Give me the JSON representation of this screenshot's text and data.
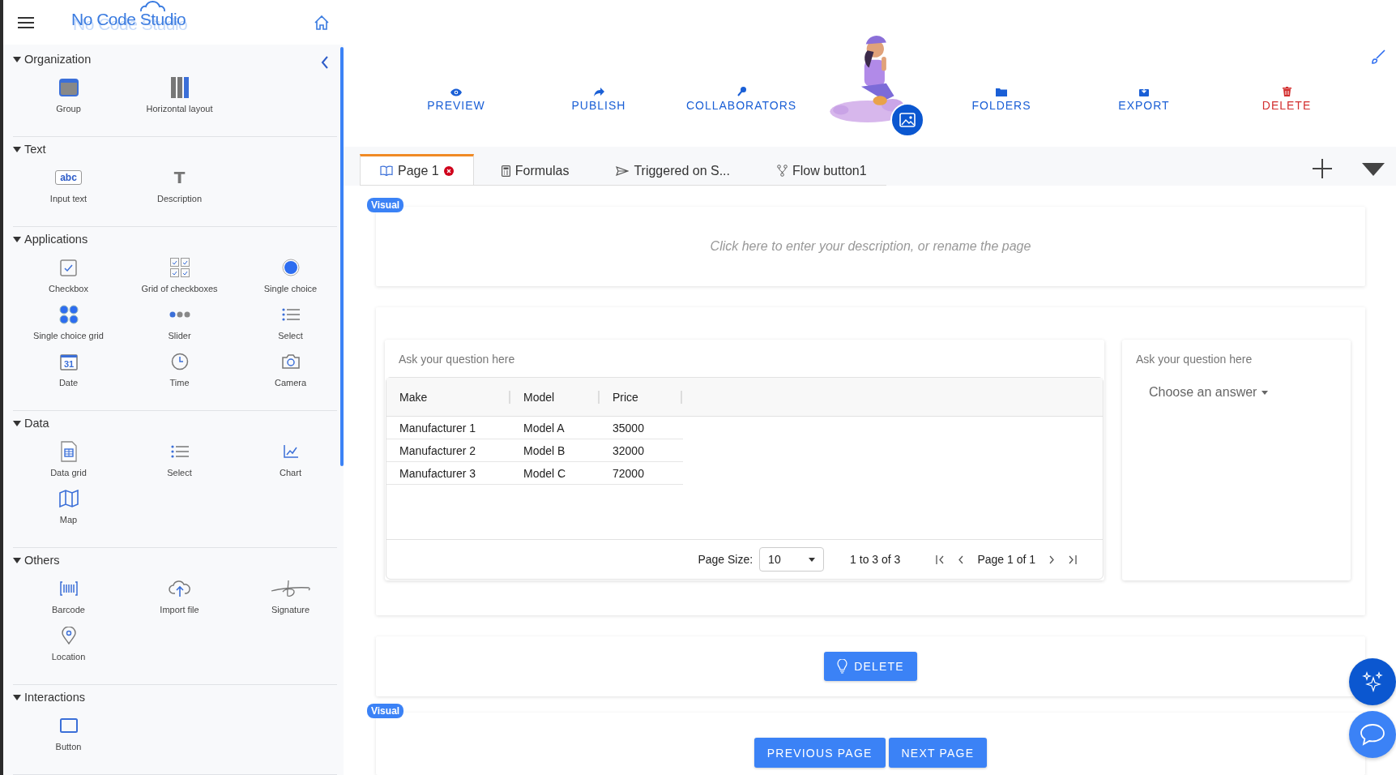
{
  "app": {
    "title": "No Code Studio"
  },
  "sidebar": {
    "sections": [
      {
        "title": "Organization",
        "expanded": true,
        "items": [
          {
            "label": "Group",
            "kind": "group"
          },
          {
            "label": "Horizontal layout",
            "kind": "columns"
          }
        ]
      },
      {
        "title": "Text",
        "expanded": true,
        "items": [
          {
            "label": "Input text",
            "kind": "text-input",
            "glyph": "abc"
          },
          {
            "label": "Description",
            "kind": "text",
            "glyph": "T"
          }
        ]
      },
      {
        "title": "Applications",
        "expanded": true,
        "items": [
          {
            "label": "Checkbox",
            "kind": "checkbox"
          },
          {
            "label": "Grid of checkboxes",
            "kind": "checkbox-grid"
          },
          {
            "label": "Single choice",
            "kind": "radio"
          },
          {
            "label": "Single choice grid",
            "kind": "radio-grid"
          },
          {
            "label": "Slider",
            "kind": "dots"
          },
          {
            "label": "Select",
            "kind": "list"
          },
          {
            "label": "Date",
            "kind": "calendar",
            "glyph": "31"
          },
          {
            "label": "Time",
            "kind": "clock"
          },
          {
            "label": "Camera",
            "kind": "camera"
          }
        ]
      },
      {
        "title": "Data",
        "expanded": true,
        "items": [
          {
            "label": "Data grid",
            "kind": "sheet"
          },
          {
            "label": "Select",
            "kind": "list"
          },
          {
            "label": "Chart",
            "kind": "chart"
          },
          {
            "label": "Map",
            "kind": "map"
          }
        ]
      },
      {
        "title": "Others",
        "expanded": true,
        "items": [
          {
            "label": "Barcode",
            "kind": "barcode"
          },
          {
            "label": "Import file",
            "kind": "upload"
          },
          {
            "label": "Signature",
            "kind": "signature"
          },
          {
            "label": "Location",
            "kind": "pin"
          }
        ]
      },
      {
        "title": "Interactions",
        "expanded": true,
        "items": [
          {
            "label": "Button",
            "kind": "button"
          }
        ]
      }
    ]
  },
  "toolbar": {
    "actions": [
      {
        "label": "PREVIEW",
        "kind": "eye",
        "danger": false
      },
      {
        "label": "PUBLISH",
        "kind": "share",
        "danger": false
      },
      {
        "label": "COLLABORATORS",
        "kind": "key",
        "danger": false
      },
      {
        "label": "FOLDERS",
        "kind": "folder",
        "danger": false
      },
      {
        "label": "EXPORT",
        "kind": "download",
        "danger": false
      },
      {
        "label": "DELETE",
        "kind": "trash",
        "danger": true
      }
    ]
  },
  "tabs": [
    {
      "label": "Page 1",
      "kind": "page",
      "selected": true,
      "error": true
    },
    {
      "label": "Formulas",
      "kind": "calculator",
      "selected": false,
      "error": false
    },
    {
      "label": "Triggered on S...",
      "kind": "send",
      "selected": false,
      "error": false
    },
    {
      "label": "Flow button1",
      "kind": "fork",
      "selected": false,
      "error": false
    }
  ],
  "description_block": {
    "badge": "Visual",
    "hint": "Click here to enter your description, or rename the page"
  },
  "grid_question": {
    "question_hint": "Ask your question here",
    "columns": [
      "Make",
      "Model",
      "Price"
    ],
    "rows": [
      [
        "Manufacturer 1",
        "Model A",
        "35000"
      ],
      [
        "Manufacturer 2",
        "Model B",
        "32000"
      ],
      [
        "Manufacturer 3",
        "Model C",
        "72000"
      ]
    ],
    "page_size_label": "Page Size:",
    "page_size": "10",
    "range": "1 to 3 of 3",
    "page": "Page 1 of 1"
  },
  "select_question": {
    "question_hint": "Ask your question here",
    "placeholder": "Choose an answer"
  },
  "action_block": {
    "button": "DELETE"
  },
  "nav_block": {
    "badge": "Visual",
    "buttons": [
      "PREVIOUS PAGE",
      "NEXT PAGE"
    ]
  }
}
